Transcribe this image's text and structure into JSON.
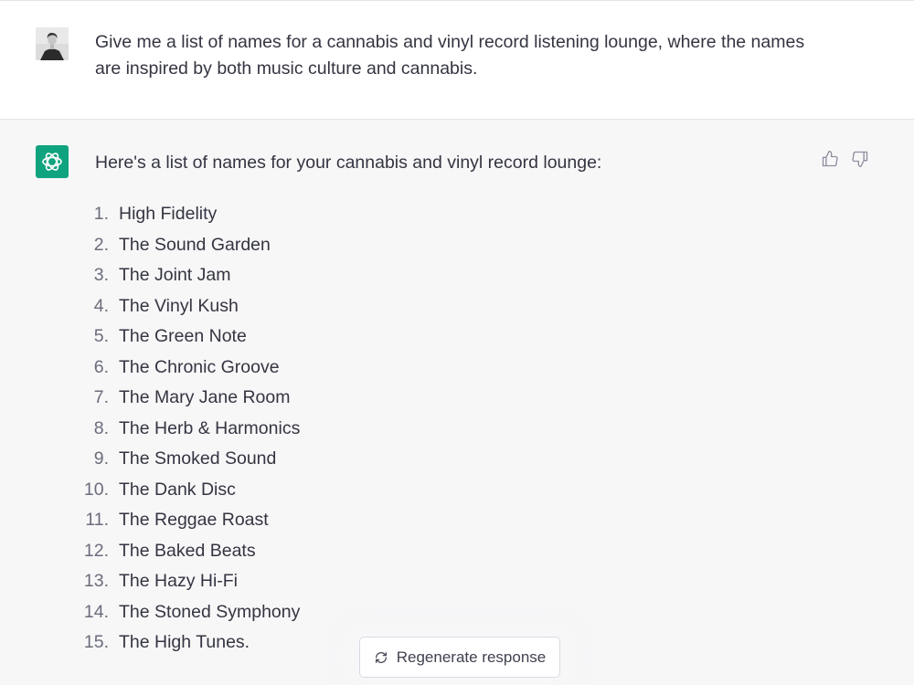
{
  "user": {
    "avatar_icon": "user-avatar-photo",
    "message": "Give me a list of names for a cannabis and vinyl record listening lounge, where the names are inspired by both music culture and cannabis."
  },
  "assistant": {
    "avatar_icon": "openai-logo-icon",
    "avatar_color": "#10a37f",
    "intro": "Here's a list of names for your cannabis and vinyl record lounge:",
    "names": [
      {
        "num": "1.",
        "text": "High Fidelity"
      },
      {
        "num": "2.",
        "text": "The Sound Garden"
      },
      {
        "num": "3.",
        "text": "The Joint Jam"
      },
      {
        "num": "4.",
        "text": "The Vinyl Kush"
      },
      {
        "num": "5.",
        "text": "The Green Note"
      },
      {
        "num": "6.",
        "text": "The Chronic Groove"
      },
      {
        "num": "7.",
        "text": "The Mary Jane Room"
      },
      {
        "num": "8.",
        "text": "The Herb & Harmonics"
      },
      {
        "num": "9.",
        "text": "The Smoked Sound"
      },
      {
        "num": "10.",
        "text": "The Dank Disc"
      },
      {
        "num": "11.",
        "text": "The Reggae Roast"
      },
      {
        "num": "12.",
        "text": "The Baked Beats"
      },
      {
        "num": "13.",
        "text": "The Hazy Hi-Fi"
      },
      {
        "num": "14.",
        "text": "The Stoned Symphony"
      },
      {
        "num": "15.",
        "text": "The High Tunes."
      }
    ],
    "feedback": {
      "up_icon": "thumbs-up-icon",
      "down_icon": "thumbs-down-icon"
    }
  },
  "regenerate": {
    "icon": "refresh-icon",
    "label": "Regenerate response"
  }
}
